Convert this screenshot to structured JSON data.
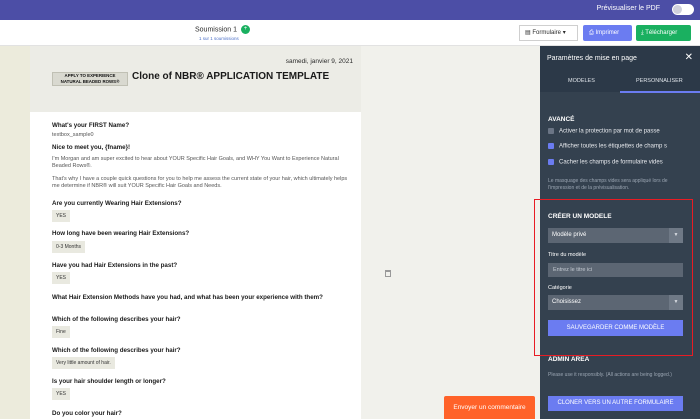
{
  "topbar": {
    "preview_label": "Prévisualiser le PDF"
  },
  "toolbar": {
    "submission_title": "Soumission 1",
    "submission_badge": "+",
    "submission_link": "1 sur 1 soumissions",
    "form_label": "Formulaire",
    "print_label": "Imprimer",
    "download_label": "Télécharger"
  },
  "doc": {
    "date": "samedi, janvier 9, 2021",
    "logo_text_1": "APPLY TO EXPERIENCE",
    "logo_text_2": "NATURAL BEADED ROWS®",
    "title": "Clone of NBR® APPLICATION TEMPLATE",
    "q_first_name": "What's your FIRST Name?",
    "a_first_name": "textbox_sample0",
    "greeting": "Nice to meet you, {fname}!",
    "intro_1": "I'm Morgan and am super excited to hear about YOUR Specific Hair Goals, and WHY You Want to Experience Natural Beaded Rows®.",
    "intro_2": "That's why I have a couple quick questions for you to help me assess the current state of your hair, which ultimately helps me determine if NBR® will suit YOUR Specific Hair Goals and Needs.",
    "questions": [
      {
        "q": "Are you currently Wearing Hair Extensions?",
        "a": "YES"
      },
      {
        "q": "How long have been wearing Hair Extensions?",
        "a": "0-3 Months"
      },
      {
        "q": "Have you had Hair Extensions in the past?",
        "a": "YES"
      },
      {
        "q": "What Hair Extension Methods have you had, and what has been your experience with them?",
        "a": ""
      },
      {
        "q": "Which of the following describes your hair?",
        "a": "Fine"
      },
      {
        "q": "Which of the following describes your hair?",
        "a": "Very little amount of hair."
      },
      {
        "q": "Is your hair shoulder length or longer?",
        "a": "YES"
      },
      {
        "q": "Do you color your hair?",
        "a": ""
      }
    ]
  },
  "panel": {
    "title": "Paramètres de mise en page",
    "close": "✕",
    "tab_models": "MODELES",
    "tab_customize": "PERSONNALISER",
    "advanced": "AVANCÉ",
    "cb_password": "Activer la protection par mot de passe",
    "cb_labels": "Afficher toutes les étiquettes de champ s",
    "cb_hide_empty": "Cacher les champs de formulaire vides",
    "note_hide": "Le masquage des champs vides sera appliqué lors de l'impression et de la prévisualisation.",
    "create_model": "CRÉER UN MODELE",
    "model_type": "Modèle privé",
    "model_title_label": "Titre du modèle",
    "model_title_placeholder": "Entrez le titre ici",
    "category_label": "Catégorie",
    "category_value": "Choisissez",
    "save_model": "SAUVEGARDER COMME MODÈLE",
    "admin": "ADMIN AREA",
    "admin_note": "Please use it responsibly. (All actions are being logged.)",
    "clone": "CLONER VERS UN AUTRE FORMULAIRE"
  },
  "send_comment": "Envoyer un commentaire"
}
